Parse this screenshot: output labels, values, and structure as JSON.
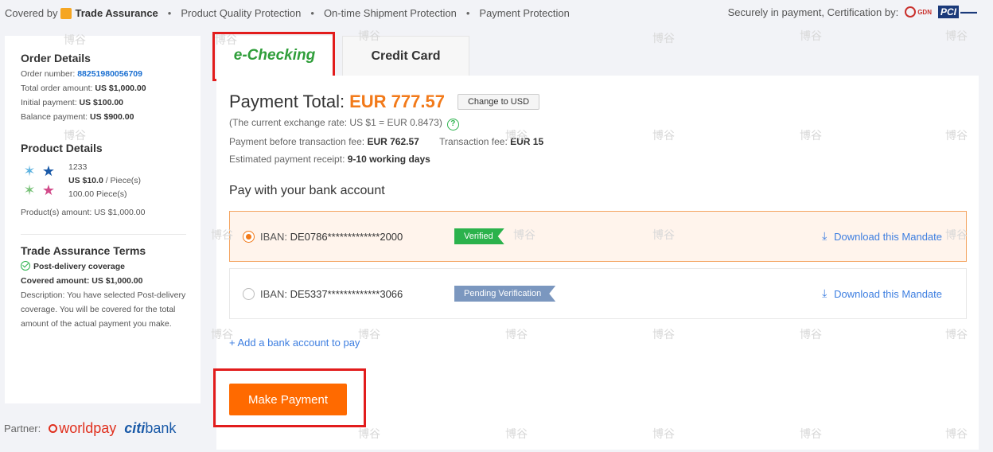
{
  "topbar": {
    "covered_by": "Covered by",
    "trade_assurance": "Trade Assurance",
    "protections": [
      "Product Quality Protection",
      "On-time Shipment Protection",
      "Payment Protection"
    ],
    "secure_text": "Securely in payment, Certification by:",
    "cert1": "GDN",
    "cert2": "PCI"
  },
  "order": {
    "title": "Order Details",
    "order_number_label": "Order number:",
    "order_number": "88251980056709",
    "total_label": "Total order amount:",
    "total": "US $1,000.00",
    "initial_label": "Initial payment:",
    "initial": "US $100.00",
    "balance_label": "Balance payment:",
    "balance": "US $900.00"
  },
  "product": {
    "title": "Product Details",
    "name": "1233",
    "price": "US $10.0",
    "unit": "/ Piece(s)",
    "qty": "100.00 Piece(s)",
    "amount_label": "Product(s) amount:",
    "amount": "US $1,000.00"
  },
  "terms": {
    "title": "Trade Assurance Terms",
    "coverage": "Post-delivery coverage",
    "covered_amount": "Covered amount: US $1,000.00",
    "description": "Description: You have selected Post-delivery coverage. You will be covered for the total amount of the actual payment you make."
  },
  "partner": {
    "label": "Partner:",
    "worldpay": "worldpay",
    "citi": "citi",
    "bank": "bank"
  },
  "tabs": {
    "echecking": "e-Checking",
    "credit": "Credit Card"
  },
  "payment": {
    "total_label": "Payment Total:",
    "total_amount": "EUR 777.57",
    "change_btn": "Change to USD",
    "exchange": "(The current exchange rate: US $1 = EUR 0.8473)",
    "before_fee_label": "Payment before transaction fee:",
    "before_fee": "EUR 762.57",
    "fee_label": "Transaction fee:",
    "fee": "EUR 15",
    "receipt_label": "Estimated payment receipt:",
    "receipt": "9-10 working days",
    "pay_with": "Pay with your bank account"
  },
  "accounts": [
    {
      "iban_label": "IBAN:",
      "iban": "DE0786*************2000",
      "status": "Verified",
      "download": "Download this Mandate"
    },
    {
      "iban_label": "IBAN:",
      "iban": "DE5337*************3066",
      "status": "Pending Verification",
      "download": "Download this Mandate"
    }
  ],
  "add_bank": "+ Add a bank account to pay",
  "make_payment": "Make Payment",
  "watermark": "博谷",
  "colors": {
    "accent_orange": "#ff6a00",
    "amount_orange": "#f27a1a",
    "verified_green": "#2bb24c",
    "pending_blue": "#7b97bf",
    "link_blue": "#3d7ee0",
    "highlight_red": "#e21c1c"
  }
}
